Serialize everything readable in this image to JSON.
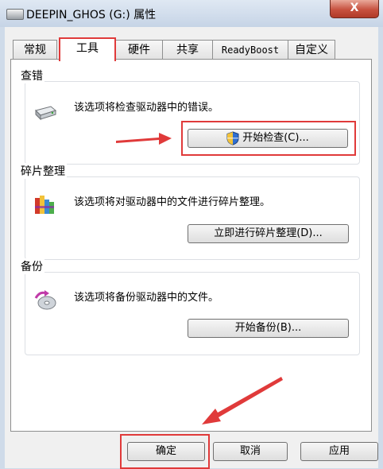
{
  "window": {
    "title": "DEEPIN_GHOS (G:) 属性",
    "close_label": "X"
  },
  "tabs": [
    "常规",
    "工具",
    "硬件",
    "共享",
    "ReadyBoost",
    "自定义"
  ],
  "active_tab": "工具",
  "groups": {
    "error_check": {
      "title": "查错",
      "description": "该选项将检查驱动器中的错误。",
      "icon": "hard-drive-icon",
      "button_label": "开始检查(C)..."
    },
    "defrag": {
      "title": "碎片整理",
      "description": "该选项将对驱动器中的文件进行碎片整理。",
      "icon": "defrag-icon",
      "button_label": "立即进行碎片整理(D)..."
    },
    "backup": {
      "title": "备份",
      "description": "该选项将备份驱动器中的文件。",
      "icon": "backup-icon",
      "button_label": "开始备份(B)..."
    }
  },
  "footer": {
    "ok_label": "确定",
    "cancel_label": "取消",
    "apply_label": "应用"
  },
  "colors": {
    "highlight": "#e03a3a",
    "titlebar": "#c6d4e6",
    "close_button": "#c7513f"
  }
}
